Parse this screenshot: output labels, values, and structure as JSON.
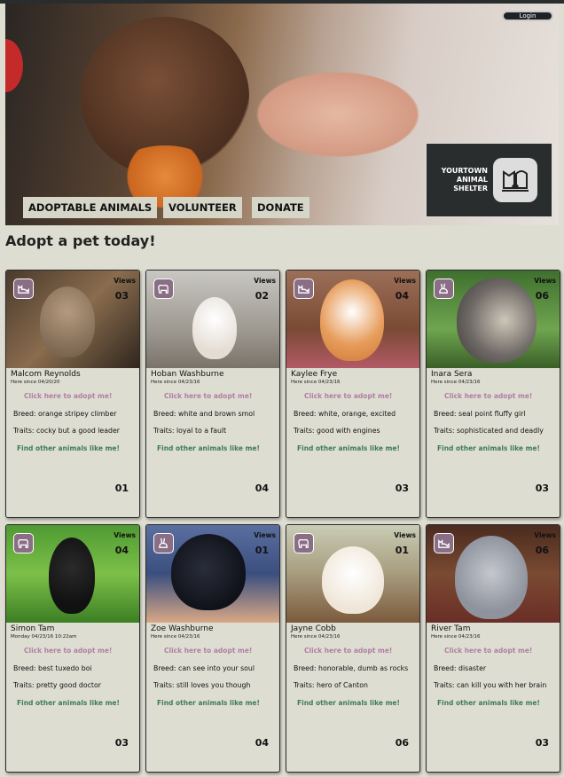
{
  "header": {
    "login_label": "Login",
    "shelter_name": "YOURTOWN ANIMAL SHELTER",
    "nav": [
      "ADOPTABLE ANIMALS",
      "VOLUNTEER",
      "DONATE"
    ]
  },
  "page_title": "Adopt a pet today!",
  "labels": {
    "views": "Views",
    "adopt": "Click here to adopt me!",
    "find": "Find other animals like me!"
  },
  "colors": {
    "accent_mauve": "#8a6e86",
    "link_pink": "#b07fa4",
    "link_green": "#3f7b57",
    "dark": "#2a2d2e",
    "background": "#ddddd1"
  },
  "pets": [
    {
      "name": "Malcom Reynolds",
      "since": "Here since 04/20/20",
      "views": "03",
      "breed": "Breed: orange stripey climber",
      "traits": "Traits: cocky but a good leader",
      "count": "01",
      "icon": "cat-icon"
    },
    {
      "name": "Hoban Washburne",
      "since": "Here since 04/23/16",
      "views": "02",
      "breed": "Breed: white and brown smol",
      "traits": "Traits: loyal to a fault",
      "count": "04",
      "icon": "dog-icon"
    },
    {
      "name": "Kaylee Frye",
      "since": "Here since 04/23/16",
      "views": "04",
      "breed": "Breed: white, orange, excited",
      "traits": "Traits: good with engines",
      "count": "03",
      "icon": "cat-icon"
    },
    {
      "name": "Inara Sera",
      "since": "Here since 04/23/16",
      "views": "06",
      "breed": "Breed: seal point fluffy girl",
      "traits": "Traits: sophisticated and deadly",
      "count": "03",
      "icon": "rabbit-icon"
    },
    {
      "name": "Simon Tam",
      "since": "Monday 04/23/16 10:22am",
      "views": "04",
      "breed": "Breed: best tuxedo boi",
      "traits": "Traits: pretty good doctor",
      "count": "03",
      "icon": "dog-icon"
    },
    {
      "name": "Zoe Washburne",
      "since": "Here since 04/23/16",
      "views": "01",
      "breed": "Breed: can see into your soul",
      "traits": "Traits: still loves you though",
      "count": "04",
      "icon": "rabbit-icon"
    },
    {
      "name": "Jayne Cobb",
      "since": "Here since 04/23/16",
      "views": "01",
      "breed": "Breed: honorable, dumb as rocks",
      "traits": "Traits: hero of Canton",
      "count": "06",
      "icon": "dog-icon"
    },
    {
      "name": "River Tam",
      "since": "Here since 04/23/16",
      "views": "06",
      "breed": "Breed: disaster",
      "traits": "Traits: can kill you with her brain",
      "count": "03",
      "icon": "cat-icon"
    }
  ]
}
